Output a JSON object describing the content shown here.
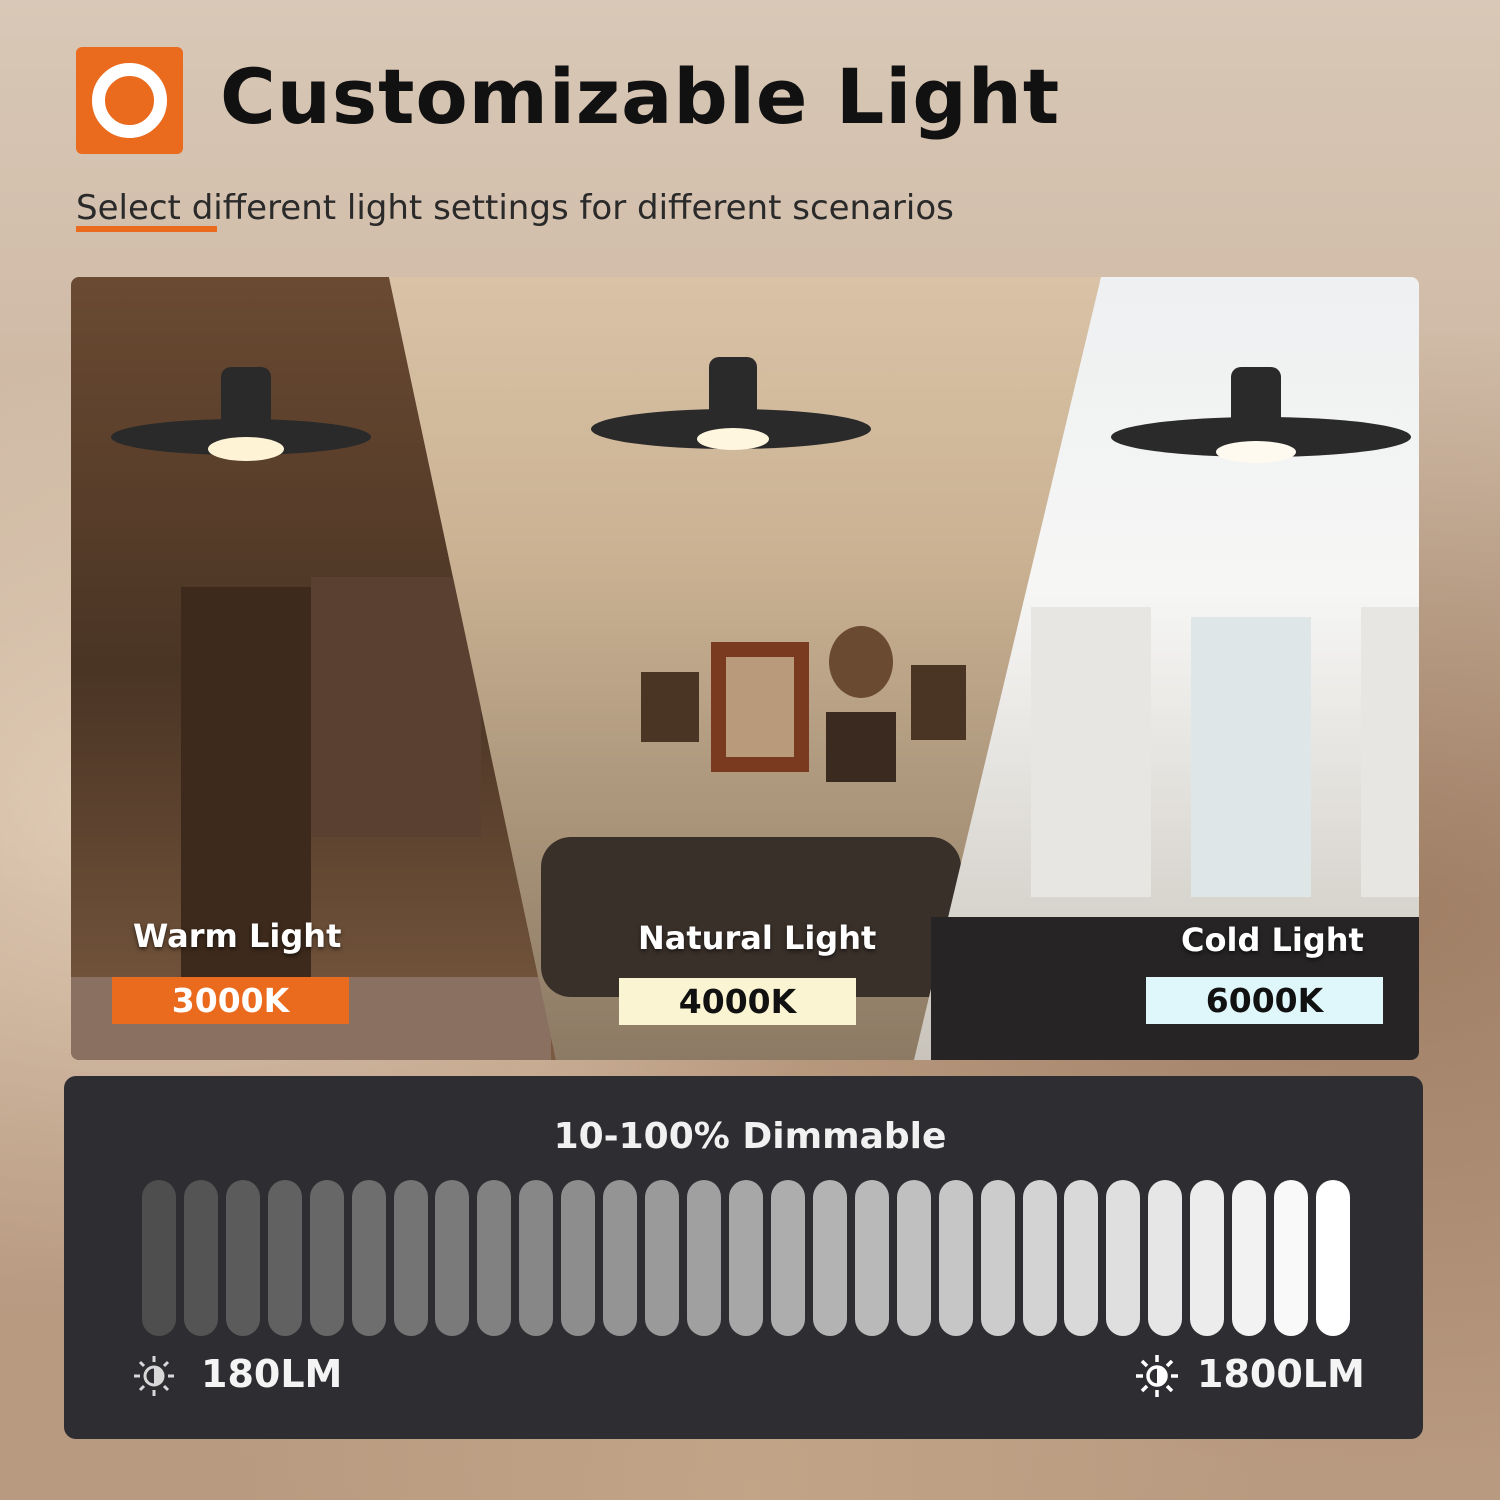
{
  "header": {
    "title": "Customizable Light",
    "subtitle": "Select different light settings for different scenarios",
    "accent_color": "#ea6a1e"
  },
  "scenes": [
    {
      "label": "Warm Light",
      "temperature": "3000K",
      "badge_color": "#ea6a1e",
      "badge_text_color": "#ffffff"
    },
    {
      "label": "Natural Light",
      "temperature": "4000K",
      "badge_color": "#fbf4d2",
      "badge_text_color": "#111111"
    },
    {
      "label": "Cold Light",
      "temperature": "6000K",
      "badge_color": "#dff6fb",
      "badge_text_color": "#111111"
    }
  ],
  "dimmer": {
    "title": "10-100%  Dimmable",
    "min_label": "180LM",
    "max_label": "1800LM",
    "bar_count": 29,
    "min_icon": "sun-dim-icon",
    "max_icon": "sun-bright-icon"
  }
}
